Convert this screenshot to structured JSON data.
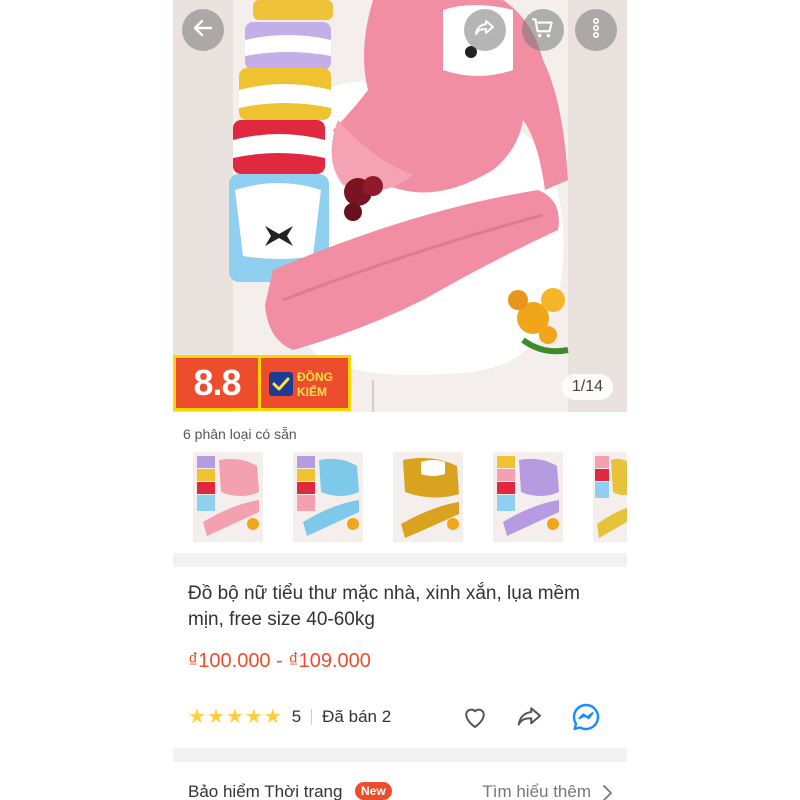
{
  "photo": {
    "counter": "1/14",
    "badge_score": "8.8",
    "badge_label_line1": "ĐỒNG",
    "badge_label_line2": "KIỂM"
  },
  "icons": {
    "back": "arrow-left-icon",
    "share": "share-icon",
    "cart": "cart-icon",
    "more": "more-vertical-icon",
    "heart": "heart-icon",
    "share_product": "share-icon",
    "messenger": "messenger-icon",
    "chevron": "chevron-right-icon"
  },
  "variations": {
    "label": "6 phân loại có sẵn",
    "thumbs": [
      {
        "color": "#f3a1b0"
      },
      {
        "color": "#7ec8ea"
      },
      {
        "color": "#d9a21f"
      },
      {
        "color": "#b79be0"
      },
      {
        "color": "#e8c23a"
      }
    ]
  },
  "product": {
    "title": "Đồ bộ nữ tiểu thư mặc nhà, xinh xắn, lụa mềm mịn, free size 40-60kg",
    "price": "₫100.000 - ₫109.000",
    "rating": "5",
    "stars": 5,
    "sold": "Đã bán 2"
  },
  "insurance": {
    "title": "Bảo hiểm Thời trang",
    "badge": "New",
    "link": "Tìm hiểu thêm"
  },
  "colors": {
    "accent": "#ee4d2d",
    "star": "#ffce3d",
    "messenger": "#1a8cff"
  }
}
